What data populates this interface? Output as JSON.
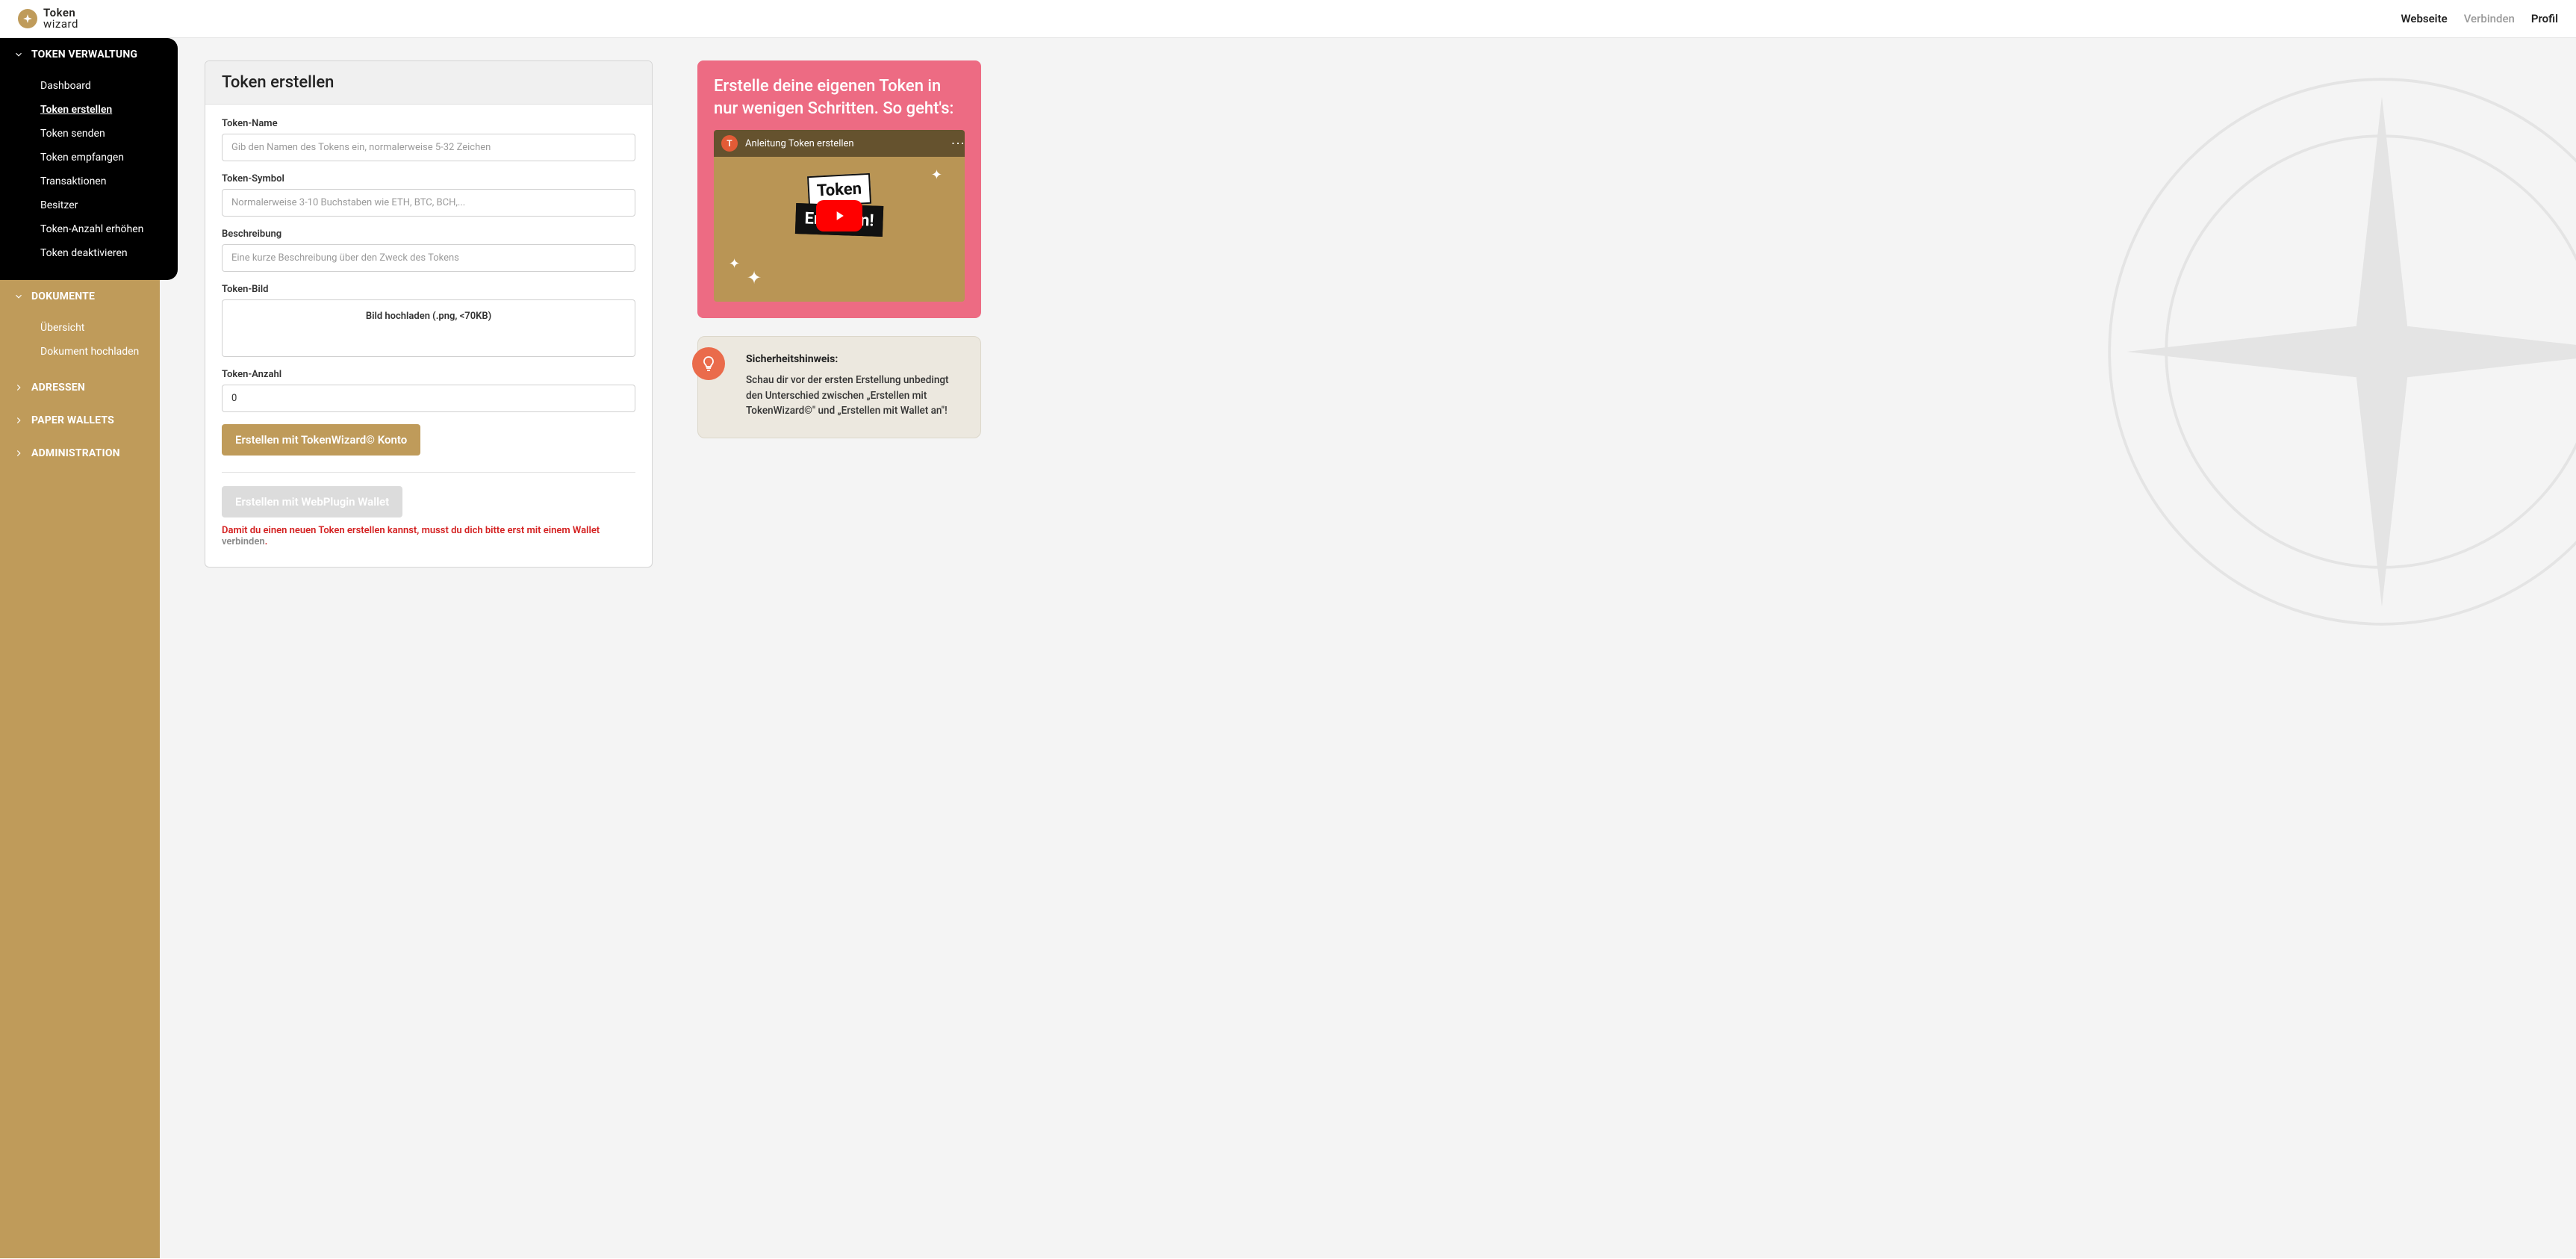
{
  "brand": {
    "line1": "Token",
    "line2": "wizard"
  },
  "topnav": {
    "website": "Webseite",
    "connect": "Verbinden",
    "profile": "Profil"
  },
  "sidebar": {
    "s0": {
      "title": "TOKEN VERWALTUNG",
      "items": [
        "Dashboard",
        "Token erstellen",
        "Token senden",
        "Token empfangen",
        "Transaktionen",
        "Besitzer",
        "Token-Anzahl erhöhen",
        "Token deaktivieren"
      ]
    },
    "s1": {
      "title": "DOKUMENTE",
      "items": [
        "Übersicht",
        "Dokument hochladen"
      ]
    },
    "s2": {
      "title": "ADRESSEN"
    },
    "s3": {
      "title": "PAPER WALLETS"
    },
    "s4": {
      "title": "ADMINISTRATION"
    }
  },
  "form": {
    "title": "Token erstellen",
    "name_label": "Token-Name",
    "name_placeholder": "Gib den Namen des Tokens ein, normalerweise 5-32 Zeichen",
    "symbol_label": "Token-Symbol",
    "symbol_placeholder": "Normalerweise 3-10 Buchstaben wie ETH, BTC, BCH,...",
    "desc_label": "Beschreibung",
    "desc_placeholder": "Eine kurze Beschreibung über den Zweck des Tokens",
    "image_label": "Token-Bild",
    "image_upload_text": "Bild hochladen (.png, <70KB)",
    "count_label": "Token-Anzahl",
    "count_value": "0",
    "btn_create_account": "Erstellen mit TokenWizard© Konto",
    "btn_create_wallet": "Erstellen mit WebPlugin Wallet",
    "error_prefix": "Damit du einen neuen Token erstellen kannst, musst du dich bitte erst mit einem Wallet ",
    "error_link": "verbinden",
    "error_suffix": "."
  },
  "promo": {
    "title": "Erstelle deine eigenen Token in nur wenigen Schritten. So geht's:",
    "video_title": "Anleitung Token erstellen",
    "video_avatar": "T",
    "video_word1": "Token",
    "video_word2": "Erstellen!"
  },
  "hint": {
    "title": "Sicherheitshinweis:",
    "text": "Schau dir vor der ersten Erstellung unbedingt den Unterschied zwischen „Erstellen mit TokenWizard©\" und „Erstellen mit Wallet an\"!"
  }
}
